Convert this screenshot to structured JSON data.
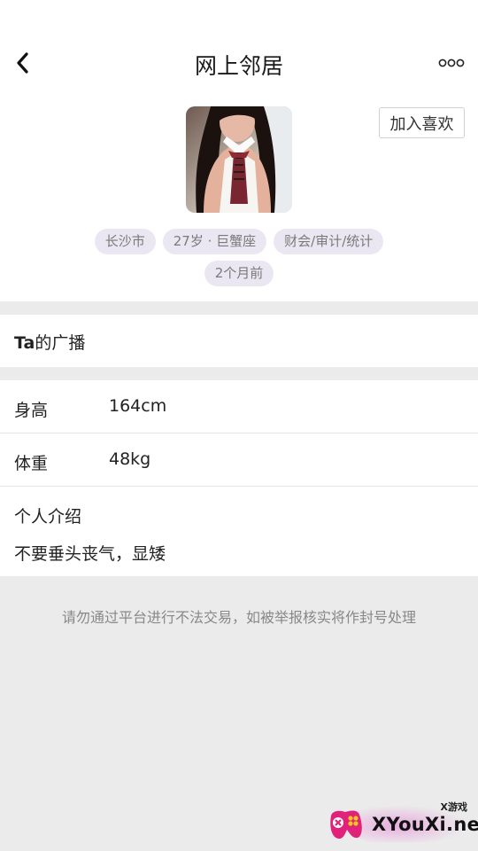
{
  "header": {
    "title": "网上邻居",
    "back_icon": "chevron-left-icon",
    "more_icon": "more-dots-icon"
  },
  "profile": {
    "like_button": "加入喜欢",
    "tags": [
      "长沙市",
      "27岁 · 巨蟹座",
      "财会/审计/统计"
    ],
    "last_active": "2个月前"
  },
  "broadcast": {
    "label_prefix": "Ta",
    "label_suffix": "的广播"
  },
  "info": {
    "height_label": "身高",
    "height_value": "164cm",
    "weight_label": "体重",
    "weight_value": "48kg",
    "intro_label": "个人介绍",
    "intro_text": "不要垂头丧气，显矮"
  },
  "notice": "请勿通过平台进行不法交易，如被举报核实将作封号处理",
  "watermark": {
    "tag": "X游戏",
    "text": "XYouXi.net"
  },
  "colors": {
    "tag_bg": "#ebe7f2",
    "page_bg": "#ebebeb"
  }
}
